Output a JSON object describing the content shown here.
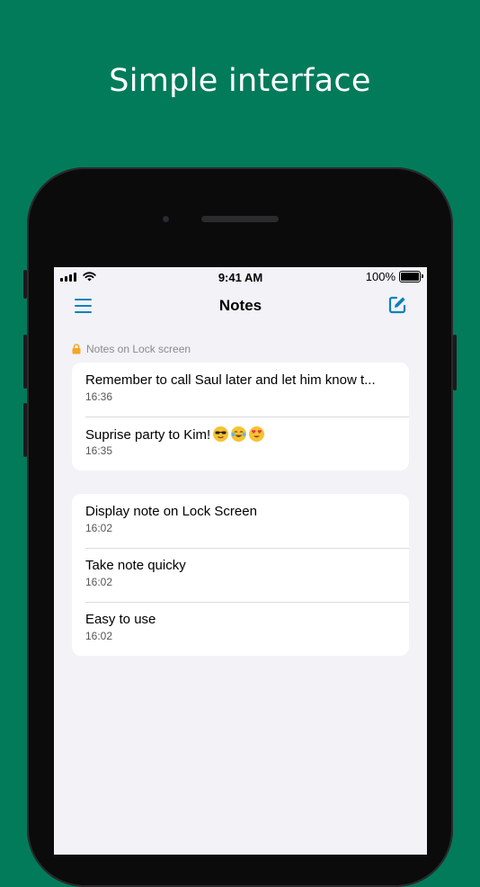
{
  "headline": "Simple interface",
  "status": {
    "time": "9:41 AM",
    "battery": "100%"
  },
  "nav": {
    "title": "Notes",
    "menu_icon": "hamburger-menu-icon",
    "compose_icon": "compose-icon"
  },
  "lock_section": {
    "header": "Notes on Lock screen",
    "icon": "lock-icon",
    "notes": [
      {
        "title": "Remember to call Saul later and let him know t...",
        "time": "16:36"
      },
      {
        "title": "Suprise party to Kim!",
        "time": "16:35",
        "emojis": [
          "sunglasses-emoji",
          "tears-of-joy-emoji",
          "heart-eyes-emoji"
        ]
      }
    ]
  },
  "notes": [
    {
      "title": "Display note on Lock Screen",
      "time": "16:02"
    },
    {
      "title": "Take note quicky",
      "time": "16:02"
    },
    {
      "title": "Easy to use",
      "time": "16:02"
    }
  ],
  "colors": {
    "background": "#027b5b",
    "accent": "#0c82b8",
    "lock": "#f5a623"
  }
}
